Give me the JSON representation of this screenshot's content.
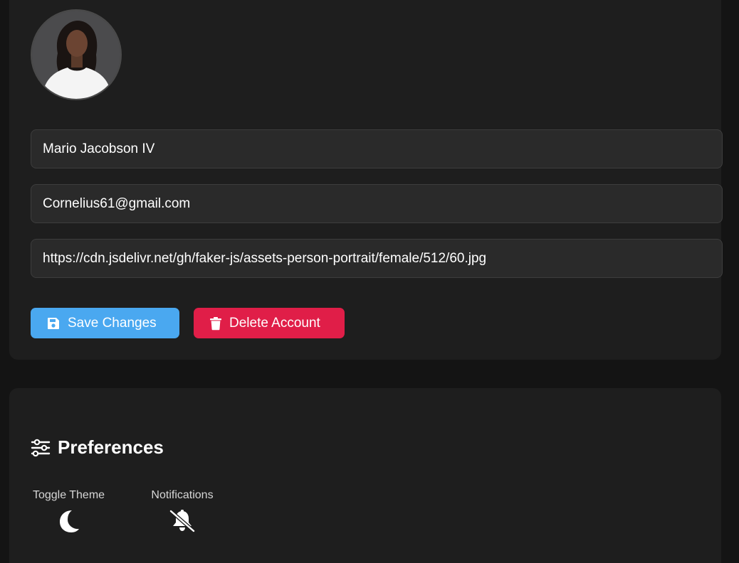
{
  "profile": {
    "avatar_alt": "Profile avatar",
    "name": "Mario Jacobson IV",
    "email": "Cornelius61@gmail.com",
    "avatar_url": "https://cdn.jsdelivr.net/gh/faker-js/assets-person-portrait/female/512/60.jpg",
    "save_label": "Save Changes",
    "delete_label": "Delete Account",
    "colors": {
      "save": "#4aa8f0",
      "delete": "#e01e48"
    }
  },
  "preferences": {
    "title": "Preferences",
    "title_icon": "sliders-icon",
    "theme": {
      "label": "Toggle Theme",
      "icon": "moon-icon"
    },
    "notifications": {
      "label": "Notifications",
      "icon": "bell-slash-icon"
    }
  }
}
